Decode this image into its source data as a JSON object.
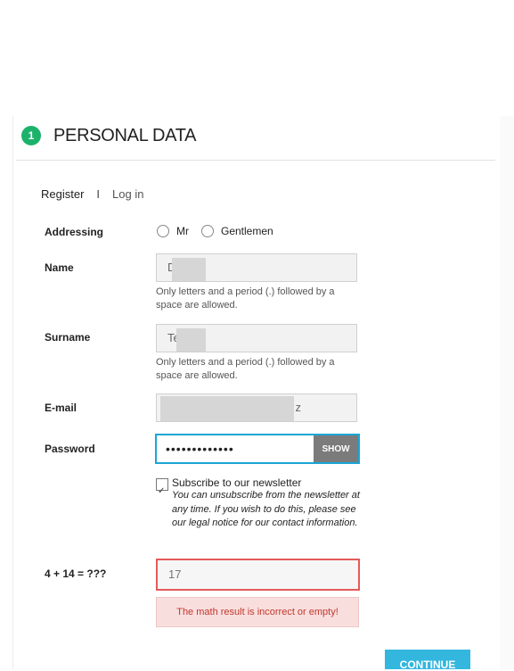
{
  "section": {
    "step": "1",
    "title": "PERSONAL DATA"
  },
  "tabs": {
    "register": "Register",
    "separator": "I",
    "login": "Log in"
  },
  "addressing": {
    "label": "Addressing",
    "options": [
      "Mr",
      "Gentlemen"
    ]
  },
  "name": {
    "label": "Name",
    "value": "D",
    "hint": "Only letters and a period (.) followed by a space are allowed."
  },
  "surname": {
    "label": "Surname",
    "value": "Te",
    "hint": "Only letters and a period (.) followed by a space are allowed."
  },
  "email": {
    "label": "E-mail",
    "value": "z"
  },
  "password": {
    "label": "Password",
    "value": "•••••••••••••",
    "show_label": "SHOW"
  },
  "newsletter": {
    "title": "Subscribe to our newsletter",
    "description": "You can unsubscribe from the newsletter at any time. If you wish to do this, please see our legal notice for our contact information."
  },
  "captcha": {
    "label": "4 + 14 = ???",
    "value": "17",
    "error": "The math result is incorrect or empty!"
  },
  "actions": {
    "continue_label": "CONTINUE"
  },
  "colors": {
    "accent": "#1db26b",
    "focus": "#1aa6d6",
    "error": "#e35a5a",
    "button": "#33b7de"
  },
  "icons": {
    "step": "step-badge-icon",
    "check": "checkmark-icon"
  }
}
